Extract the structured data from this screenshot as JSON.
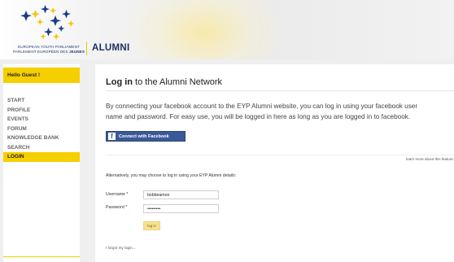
{
  "header": {
    "logo_line1": "EUROPEAN YOUTH PARLIAMENT",
    "logo_line2_prefix": "PARLEMENT EUROPÉEN DES ",
    "logo_line2_bold": "JEUNES",
    "site_title": "ALUMNI"
  },
  "sidebar": {
    "greeting": "Hello Guest !",
    "items": [
      {
        "label": "START"
      },
      {
        "label": "PROFILE"
      },
      {
        "label": "EVENTS"
      },
      {
        "label": "FORUM"
      },
      {
        "label": "KNOWLEDGE BANK"
      },
      {
        "label": "SEARCH"
      },
      {
        "label": "LOGIN"
      }
    ],
    "active_item": "LOGIN"
  },
  "main": {
    "title_bold": "Log in",
    "title_rest": " to the Alumni Network",
    "intro_line1": "By connecting your facebook account to the EYP Alumni website, you can log in using your facebook user",
    "intro_line2": "name and password. For easy use, you will be logged in here as long as you are logged in to facebook.",
    "fb_button_icon": "f",
    "fb_button_label": "Connect with Facebook",
    "learn_more": "learn more about this feature.",
    "alternative_text": "Alternatively, you may choose to log in using your EYP Alumni details:",
    "username_label": "Username *",
    "username_value": "bobbeamon",
    "password_label": "Password *",
    "password_value": "•••••••••",
    "login_button": "log in",
    "forgot_link": "I forgot my login..."
  },
  "colors": {
    "accent_yellow": "#f5cf00",
    "brand_blue": "#1a3060",
    "facebook_blue": "#3b5998"
  }
}
